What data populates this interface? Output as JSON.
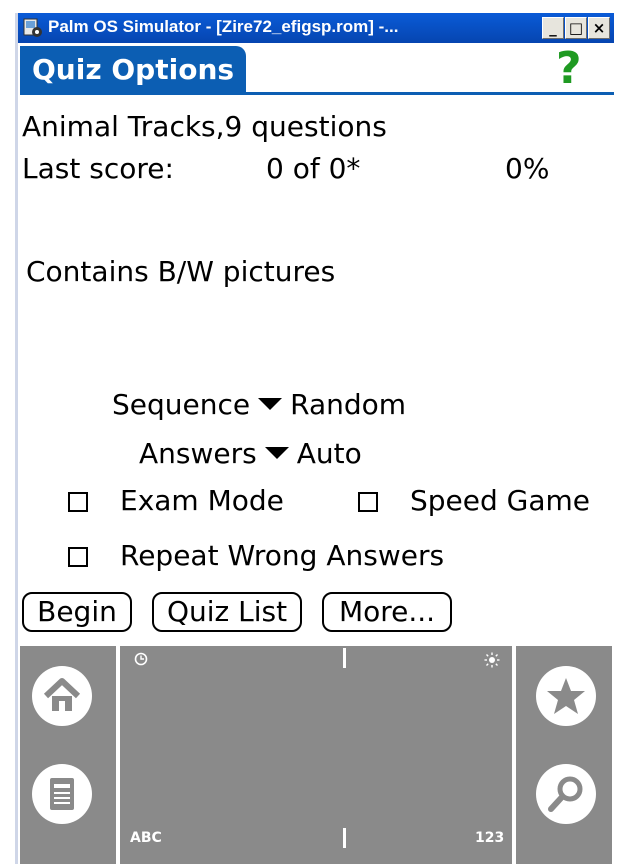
{
  "window": {
    "title": "Palm OS Simulator - [Zire72_efigsp.rom] -...",
    "buttons": {
      "minimize": "_",
      "maximize": "□",
      "close": "×"
    }
  },
  "form": {
    "title": "Quiz Options",
    "help_glyph": "?"
  },
  "quiz": {
    "name_line": "Animal Tracks,9 questions",
    "last_score_label": "Last score:",
    "last_score_value": "0 of 0*",
    "last_score_percent": "0%",
    "contains": "Contains B/W pictures"
  },
  "options": {
    "sequence_label": "Sequence",
    "sequence_value": "Random",
    "answers_label": "Answers",
    "answers_value": "Auto",
    "exam_mode": {
      "label": "Exam Mode",
      "checked": false
    },
    "speed_game": {
      "label": "Speed Game",
      "checked": false
    },
    "repeat_wrong": {
      "label": "Repeat Wrong Answers",
      "checked": false
    }
  },
  "actions": {
    "begin": "Begin",
    "quiz_list": "Quiz List",
    "more": "More..."
  },
  "graffiti": {
    "abc_label": "ABC",
    "num_label": "123",
    "icons": [
      "home-icon",
      "menu-icon",
      "favorites-icon",
      "find-icon",
      "clock-icon",
      "brightness-icon"
    ]
  }
}
